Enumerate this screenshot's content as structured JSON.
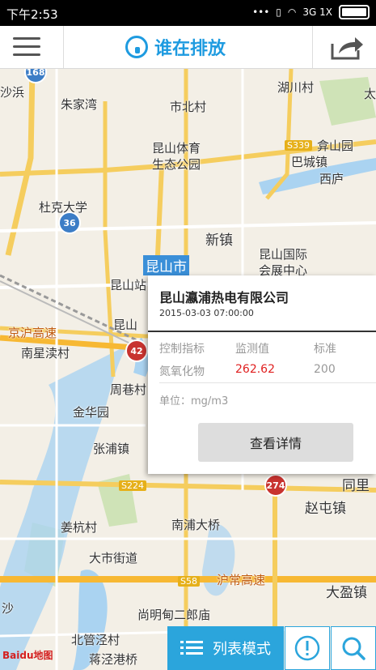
{
  "status_bar": {
    "time": "下午2:53",
    "network": "3G 1X"
  },
  "app_bar": {
    "title": "谁在排放"
  },
  "map_labels": [
    "沙浜",
    "湖川村",
    "太",
    "朱家湾",
    "市北村",
    "昆山体育",
    "生态公园",
    "S339",
    "巴城镇",
    "弇山园",
    "西庐",
    "杜克大学",
    "新镇",
    "昆山国际",
    "会展中心",
    "昆山站",
    "昆山",
    "京沪高速",
    "南星渎村",
    "周巷村",
    "金华园",
    "张浦镇",
    "S224",
    "同里",
    "赵屯镇",
    "姜杭村",
    "南浦大桥",
    "大市街道",
    "S58",
    "沪常高速",
    "大盈镇",
    "沙",
    "尚明甸二郎庙",
    "北管泾村",
    "蒋泾港桥"
  ],
  "city_highlight": "昆山市",
  "markers": [
    {
      "type": "blue",
      "count": "168"
    },
    {
      "type": "blue",
      "count": "36"
    },
    {
      "type": "red",
      "count": "42"
    },
    {
      "type": "red",
      "count": "274"
    }
  ],
  "popup": {
    "company": "昆山瀛浦热电有限公司",
    "datetime": "2015-03-03 07:00:00",
    "headers": [
      "控制指标",
      "监测值",
      "标准"
    ],
    "indicator": "氮氧化物",
    "value": "262.62",
    "standard": "200",
    "unit": "单位：mg/m3",
    "detail_button": "查看详情",
    "value_color": "#e02020"
  },
  "bottom": {
    "list_mode": "列表模式",
    "info_icon": "info-icon",
    "search_icon": "search-icon"
  },
  "baidu": "Baidu地图",
  "colors": {
    "accent": "#2ba5dc",
    "title": "#1e9be0"
  }
}
